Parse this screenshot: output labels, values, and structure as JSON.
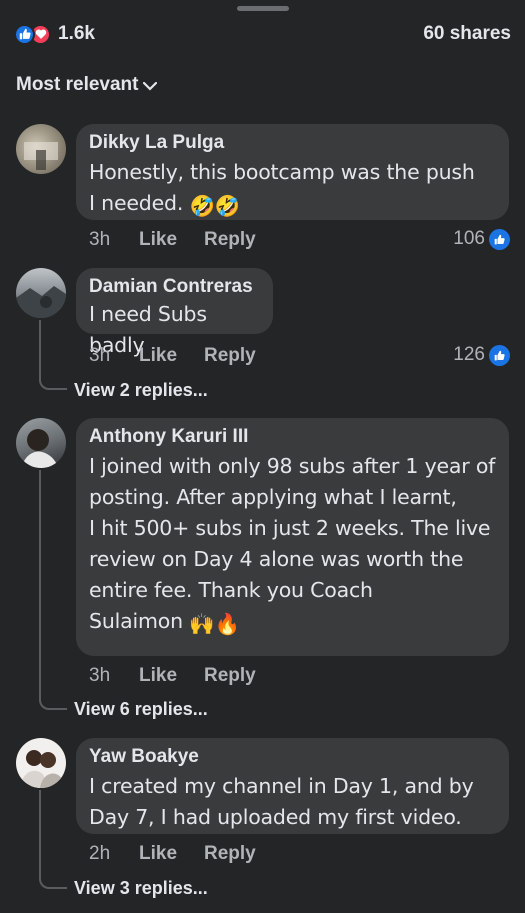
{
  "header": {
    "reaction_count": "1.6k",
    "shares": "60 shares",
    "reaction_icons": [
      "like-icon",
      "love-icon"
    ],
    "accent_like": "#1b74e4",
    "accent_love": "#f33e58"
  },
  "sort": {
    "label": "Most relevant"
  },
  "comments": [
    {
      "author": "Dikky La Pulga",
      "text_lines": [
        "Honestly, this bootcamp was the push",
        "I needed. "
      ],
      "emoji": "🤣🤣",
      "time": "3h",
      "like": "Like",
      "reply": "Reply",
      "likes": "106"
    },
    {
      "author": "Damian Contreras",
      "text_lines": [
        "I need Subs badly"
      ],
      "time": "3h",
      "like": "Like",
      "reply": "Reply",
      "likes": "126",
      "view_replies": "View 2 replies..."
    },
    {
      "author": "Anthony Karuri III",
      "text_lines": [
        "I joined with only 98 subs after 1 year of",
        "posting. After applying what I learnt,",
        "I hit 500+ subs in just 2 weeks. The live",
        "review on Day 4 alone was worth the",
        "entire fee. Thank you Coach",
        "Sulaimon "
      ],
      "emoji": "🙌🔥",
      "time": "3h",
      "like": "Like",
      "reply": "Reply",
      "view_replies": "View 6 replies..."
    },
    {
      "author": "Yaw Boakye",
      "text_lines": [
        "I created my channel in Day 1, and by",
        "Day 7, I had uploaded my first video."
      ],
      "time": "2h",
      "like": "Like",
      "reply": "Reply",
      "view_replies": "View 3 replies..."
    }
  ]
}
